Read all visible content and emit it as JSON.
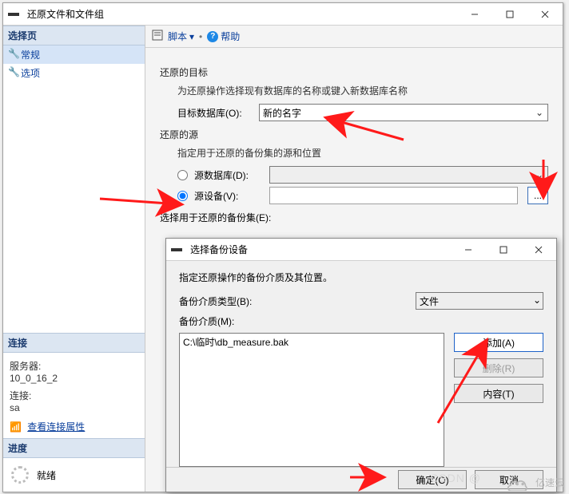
{
  "main": {
    "title": "还原文件和文件组",
    "left": {
      "select_page": "选择页",
      "nav": {
        "general": "常规",
        "options": "选项"
      },
      "connect": {
        "hd": "连接",
        "server_lbl": "服务器:",
        "server_val": "10_0_16_2",
        "conn_lbl": "连接:",
        "conn_val": "sa",
        "view_link": "查看连接属性"
      },
      "progress": {
        "hd": "进度",
        "status": "就绪"
      }
    },
    "toolbar": {
      "script": "脚本",
      "help": "帮助"
    },
    "form": {
      "dest_hd": "还原的目标",
      "dest_sub": "为还原操作选择现有数据库的名称或键入新数据库名称",
      "dest_db_lbl": "目标数据库(O):",
      "dest_db_val": "新的名字",
      "src_hd": "还原的源",
      "src_sub": "指定用于还原的备份集的源和位置",
      "src_db_lbl": "源数据库(D):",
      "src_dev_lbl": "源设备(V):",
      "sets_lbl": "选择用于还原的备份集(E):",
      "ellipsis": "..."
    }
  },
  "child": {
    "title": "选择备份设备",
    "msg": "指定还原操作的备份介质及其位置。",
    "media_type_lbl": "备份介质类型(B):",
    "media_type_val": "文件",
    "media_lbl": "备份介质(M):",
    "media_items": [
      "C:\\临时\\db_measure.bak"
    ],
    "btns": {
      "add": "添加(A)",
      "remove": "删除(R)",
      "content": "内容(T)"
    },
    "footer": {
      "ok": "确定(O)",
      "cancel": "取消"
    }
  },
  "watermark": {
    "csdn": "CSDN @",
    "brand": "亿速云"
  }
}
